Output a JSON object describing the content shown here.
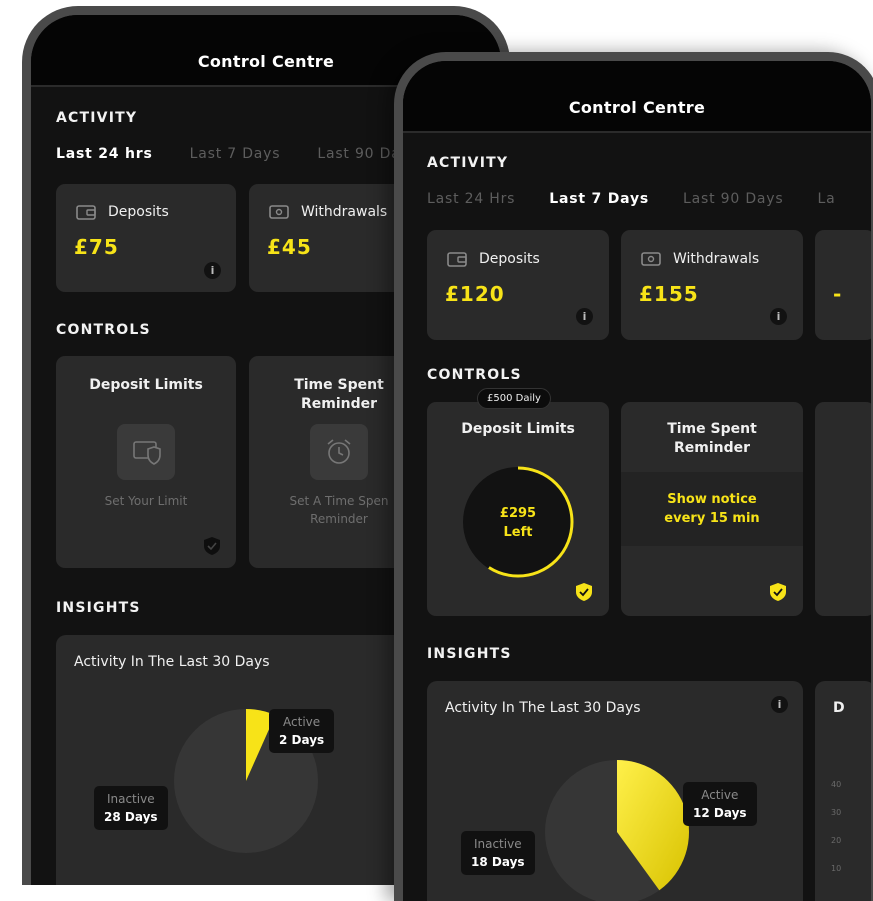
{
  "back_phone": {
    "title": "Control Centre",
    "activity_heading": "ACTIVITY",
    "tabs": [
      "Last 24 hrs",
      "Last 7 Days",
      "Last 90 Da"
    ],
    "active_tab": 0,
    "cards": [
      {
        "label": "Deposits",
        "amount": "£75",
        "icon": "wallet-icon"
      },
      {
        "label": "Withdrawals",
        "amount": "£45",
        "icon": "cash-icon"
      }
    ],
    "controls_heading": "CONTROLS",
    "controls": [
      {
        "title": "Deposit Limits",
        "subtitle": "Set Your Limit",
        "icon": "wallet-shield-icon"
      },
      {
        "title_line1": "Time Spent",
        "title_line2": "Reminder",
        "subtitle_line1": "Set A Time Spen",
        "subtitle_line2": "Reminder",
        "icon": "alarm-clock-icon"
      }
    ],
    "insights_heading": "INSIGHTS",
    "insight": {
      "title": "Activity In The Last 30 Days",
      "active_label": "Active",
      "active_value": "2 Days",
      "inactive_label": "Inactive",
      "inactive_value": "28 Days"
    },
    "chart_data": {
      "type": "pie",
      "categories": [
        "Active",
        "Inactive"
      ],
      "values": [
        2,
        28
      ]
    }
  },
  "front_phone": {
    "title": "Control Centre",
    "activity_heading": "ACTIVITY",
    "tabs": [
      "Last 24 Hrs",
      "Last 7 Days",
      "Last 90 Days",
      "La"
    ],
    "active_tab": 1,
    "cards": [
      {
        "label": "Deposits",
        "amount": "£120",
        "icon": "wallet-icon"
      },
      {
        "label": "Withdrawals",
        "amount": "£155",
        "icon": "cash-icon"
      }
    ],
    "partial_card_amount": "-",
    "controls_heading": "CONTROLS",
    "deposit_limit": {
      "badge": "£500 Daily",
      "title": "Deposit Limits",
      "remaining_amount": "£295",
      "remaining_label": "Left",
      "remaining_fraction": 0.59
    },
    "time_spent": {
      "title_line1": "Time Spent",
      "title_line2": "Reminder",
      "notice_line1": "Show notice",
      "notice_line2": "every 15 min"
    },
    "insights_heading": "INSIGHTS",
    "insight": {
      "title": "Activity In The Last 30 Days",
      "active_label": "Active",
      "active_value": "12 Days",
      "inactive_label": "Inactive",
      "inactive_value": "18 Days"
    },
    "partial_insight_letter": "D",
    "partial_axis_ticks": [
      "40",
      "30",
      "20",
      "10"
    ],
    "chart_data": {
      "type": "pie",
      "categories": [
        "Active",
        "Inactive"
      ],
      "values": [
        12,
        18
      ]
    }
  },
  "colors": {
    "accent": "#f7e318",
    "card": "#2a2a2a",
    "screen": "#121212",
    "muted_text": "#5d5d5d"
  }
}
